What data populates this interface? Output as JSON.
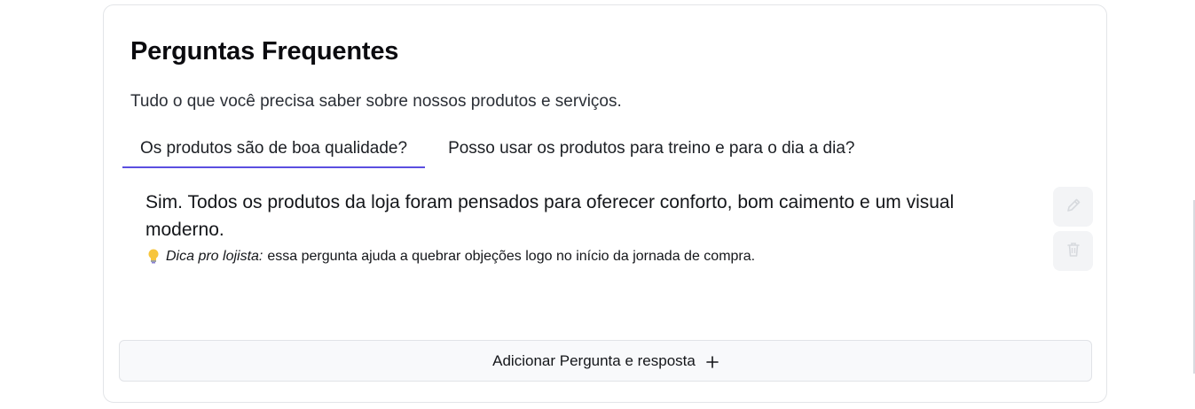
{
  "faq": {
    "title": "Perguntas Frequentes",
    "subtitle": "Tudo o que você precisa saber sobre nossos produtos e serviços.",
    "tabs": [
      {
        "label": "Os produtos são de boa qualidade?",
        "active": true
      },
      {
        "label": "Posso usar os produtos para treino e para o dia a dia?",
        "active": false
      }
    ],
    "answer": "Sim. Todos os produtos da loja foram pensados para oferecer conforto, bom caimento e um visual moderno.",
    "tip": {
      "icon": "lightbulb-icon",
      "label": "Dica pro lojista:",
      "text": "essa pergunta ajuda a quebrar objeções logo no início da jornada de compra."
    },
    "actions": {
      "edit_icon": "pencil-icon",
      "delete_icon": "trash-icon"
    },
    "add_button": {
      "label": "Adicionar Pergunta e resposta",
      "icon": "plus-icon"
    }
  },
  "colors": {
    "accent": "#5b4fe0",
    "text": "#14161a",
    "action_bg": "#f3f4f6",
    "border": "#e3e5e8"
  }
}
